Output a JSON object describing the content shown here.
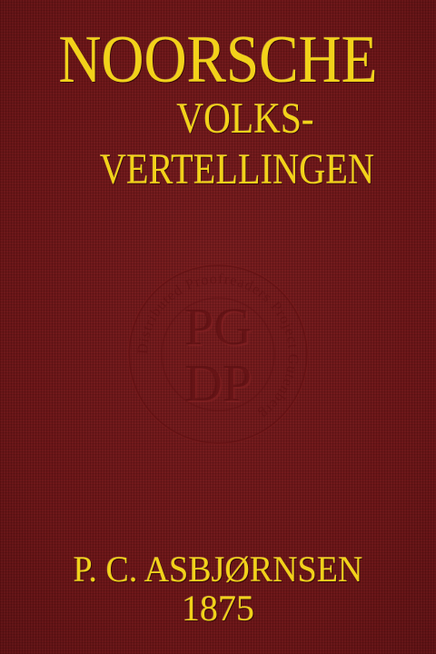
{
  "cover": {
    "title_line1": "NOORSCHE",
    "title_line2": "VOLKS-",
    "title_line3": "VERTELLINGEN",
    "author": "P. C. ASBJØRNSEN",
    "year": "1875",
    "seal": {
      "letters_top": "PG",
      "letters_bottom": "DP",
      "ring_text": "Distributed Proofreaders Project Gutenberg"
    },
    "colors": {
      "background": "#6f1517",
      "gold_text": "#f2d21a",
      "seal_emboss": "#5c0f11"
    }
  }
}
